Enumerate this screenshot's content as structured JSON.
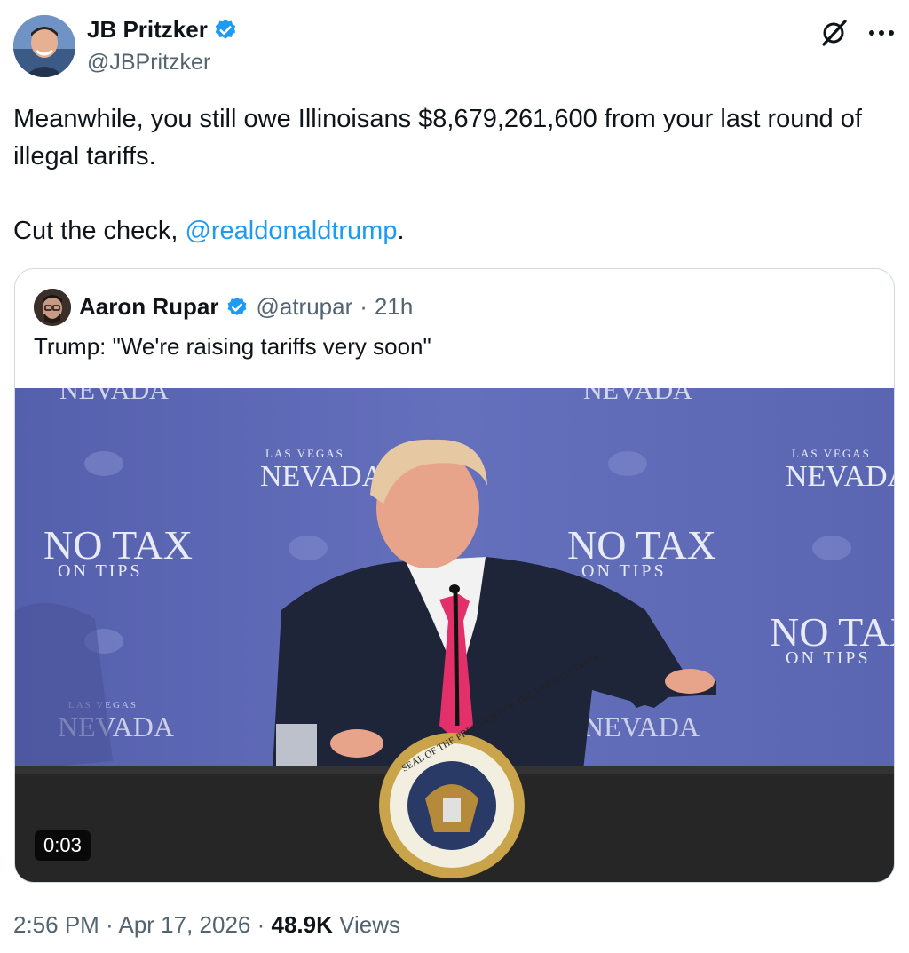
{
  "author": {
    "name": "JB Pritzker",
    "handle": "@JBPritzker",
    "verified": true
  },
  "tweet": {
    "line1": "Meanwhile, you still owe Illinoisans $8,679,261,600 from your last round of illegal tariffs.",
    "line2_prefix": "Cut the check, ",
    "mention": "@realdonaldtrump",
    "line2_suffix": "."
  },
  "quoted": {
    "name": "Aaron Rupar",
    "handle": "@atrupar",
    "separator": "·",
    "time": "21h",
    "text": "Trump: \"We're raising tariffs very soon\"",
    "video": {
      "duration": "0:03",
      "backdrop_texts": [
        "NEVADA",
        "LAS VEGAS",
        "NEVADA",
        "NO TAX",
        "ON TIPS",
        "NO TAX",
        "ON TIPS",
        "NO TAX",
        "ON TIPS",
        "NEVADA",
        "LAS VEGAS",
        "NEVADA"
      ],
      "seal_text": "SEAL OF THE PRESIDENT OF THE UNITED STATES"
    }
  },
  "footer": {
    "time": "2:56 PM",
    "sep1": " · ",
    "date": "Apr 17, 2026",
    "sep2": " · ",
    "views_count": "48.9K",
    "views_label": " Views"
  },
  "colors": {
    "accent": "#1d9bf0",
    "verified_badge": "#1d9bf0",
    "secondary_text": "#536471",
    "backdrop": "#5b66b3"
  },
  "icons": [
    "verified-badge-icon",
    "grok-icon",
    "more-icon"
  ]
}
